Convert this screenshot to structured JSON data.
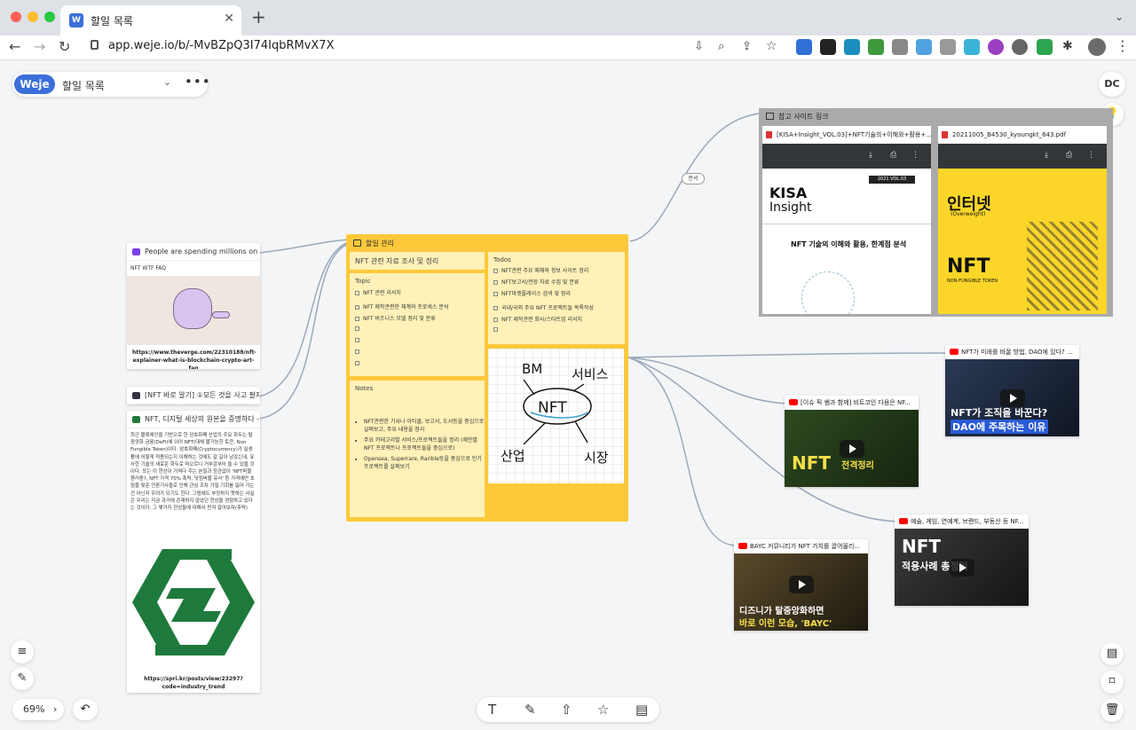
{
  "browser": {
    "tab_title": "할일 목록",
    "tab_favicon": "W",
    "url": "app.weje.io/b/-MvBZpQ3I74IqbRMvX7X"
  },
  "app": {
    "logo": "Weje",
    "board_name": "할일 목록",
    "user_initials": "DC",
    "zoom": "69%"
  },
  "task_board": {
    "title": "할일 관리",
    "heading": "NFT 관련 자료 조사 및 정리",
    "topic_label": "Topic",
    "topic_items": [
      "NFT 관련 리서치",
      "NFT 제작관련한 체계와 프로세스 분석",
      "NFT 비즈니스 모델 정리 및 분류"
    ],
    "todos_label": "Todos",
    "todo_items": [
      "NFT관련 주요 매체와 정보 사이트 정리",
      "NFT보고서/전망 자료 수집 및 분류",
      "NFT마켓플레이스 검색 및 정리",
      "국내/국외 주요 NFT 프로젝트들 목록작성",
      "NFT 제작관련 회사/스타트업 리서치"
    ],
    "notes_label": "Notes",
    "notes_items": [
      "NFT관련한 기사나 아티클, 보고서, 도서등을 중심으로 살펴보고, 주요 내용을 정리",
      "주요 카테고리별 서비스/프로젝트들을 정리 (제안별 NFT 프로젝트나 프로젝트들을 중심으로)",
      "Opensea, Superrare, Rarible등을 중심으로 인기 프로젝트를 살펴보기"
    ],
    "drawing_words": [
      "BM",
      "서비스",
      "NFT",
      "산업",
      "시장"
    ]
  },
  "left_cards": {
    "verge": {
      "title": "People are spending millions on NF...",
      "subtitle": "NFT WTF FAQ",
      "link": "https://www.theverge.com/22310188/nft-explainer-what-is-blockchain-crypto-art-faq"
    },
    "middle": {
      "title": "[NFT 바로 알기] ①모든 것을 사고 팔자..."
    },
    "spri": {
      "title": "NFT, 디지털 세상의 원본을 증명하다 - S...",
      "body": "최근 블록체인을 기반으로 한 암호화폐 산업의 주요 화두는 탈중앙화 금융(DeFi)에 이어 NFT(대체 불가능한 토큰, Non Fungible Token)이다. 암호화폐(Cryptocurrency)가 실생활에 어떻게 적용되는지 이해하는 것에도 갈 길이 남았는데, 유사한 기술의 새로운 화두로 떠오르니 거부감부터 들 수 있을 것이다. 또는 이 현상이 거쳐다 주는 본질과 장관없이 'NFT퍼블 붐러종?, NFT 가격 70% 폭락, 닷컴버블 유사' 등 가격에만 초점을 맞춘 언론기사들로 인해 관심 조차 가질 기회를 잃어 가는 건 아닌지 우려가 되기도 한다. 그럼에도 부정하지 못하는 사실은 우리는 지금 과거에 존재하지 않았던 현상을 경험하고 있다는 것이다. 그 몇가지 현상들에 대해서 먼저 알아보자(후략)",
      "link": "https://spri.kr/posts/view/23297?code=industry_trend"
    }
  },
  "reference": {
    "title": "참고 사이트 링크",
    "connector_label": "문서",
    "pdfs": [
      {
        "name": "[KISA+Insight_VOL.03]+NFT기술의+이해와+활용+...",
        "brand": "KISA",
        "brand2": "Insight",
        "vol": "2021 VOL.03",
        "cover_title": "NFT 기술의 이해와 활용, 한계점 분석"
      },
      {
        "name": "20211005_B4530_kyoungkt_643.pdf",
        "brand": "인터넷",
        "brand2": "(Overweight)",
        "cover_title": "NFT",
        "cover_sub": "NON-FUNGIBLE TOKEN"
      }
    ]
  },
  "videos": [
    {
      "title": "NFT가 미래를 바꿀 방법, DAO에 있다? ...",
      "thumb_line1": "NFT가 조직을 바꾼다?",
      "thumb_line2": "DAO에 주목하는 이유"
    },
    {
      "title": "[이슈 픽 쌤과 함께] 비트코인 다음은 NF...",
      "thumb_line1": "NFT",
      "thumb_line2": "전격정리"
    },
    {
      "title": "예술, 게임, 연예계, 브랜드, 부동산 등 NF...",
      "thumb_line1": "NFT",
      "thumb_line2": "적용사례 총정리"
    },
    {
      "title": "BAYC 커뮤니티가 NFT 가치를 끌어올리...",
      "thumb_line1": "디즈니가 탈중앙화하면",
      "thumb_line2": "바로 이런 모습, 'BAYC'"
    }
  ],
  "colors": {
    "accent": "#3b6fd9",
    "board_yellow": "#fdc93a",
    "pane_yellow": "#fff1b8",
    "youtube_red": "#ff0000",
    "spri_green": "#1e7a3c"
  },
  "icons": [
    "back-arrow-icon",
    "forward-arrow-icon",
    "reload-icon",
    "lock-icon",
    "star-icon",
    "text-tool-icon",
    "pen-tool-icon",
    "upload-icon",
    "favorite-icon",
    "note-icon",
    "bulb-icon",
    "list-icon",
    "bookmark-icon",
    "trash-icon",
    "undo-icon"
  ]
}
